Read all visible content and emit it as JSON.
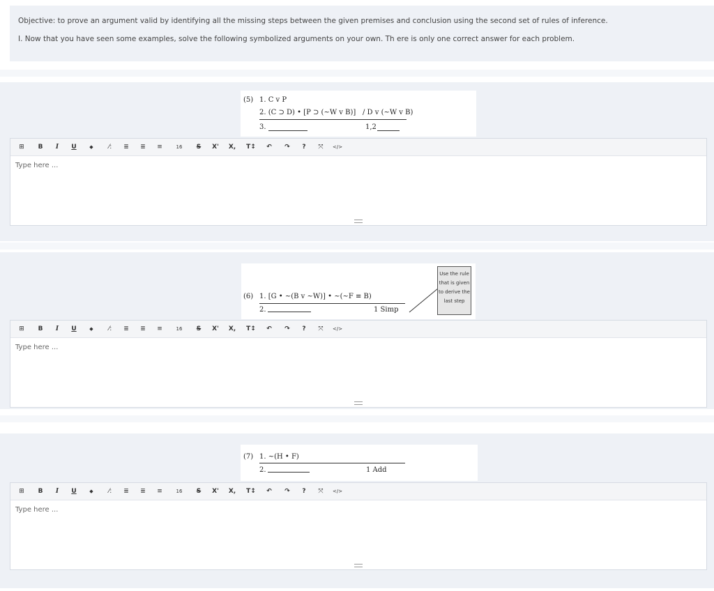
{
  "intro": {
    "objective": "Objective: to prove an argument valid by identifying all the missing steps between the given premises and conclusion using the second set of rules of inference.",
    "instruction": "I. Now that you have seen some examples, solve the following symbolized arguments on your own. Th ere is only one correct answer for each problem."
  },
  "toolbar": {
    "table": "⊞",
    "bold": "B",
    "italic": "I",
    "underline": "U",
    "marker": "◆",
    "magic": "⁄:",
    "list1": "≣",
    "list2": "≣",
    "align": "≡",
    "fontsize": "16",
    "strike": "S",
    "sup": "X'",
    "sub": "X,",
    "textstyle": "T↕",
    "undo": "↶",
    "redo": "↷",
    "help": "?",
    "fullscreen": "⤧",
    "code": "</>"
  },
  "problems": [
    {
      "number": "(5)",
      "lines": [
        "1. C v P",
        "2. (C ⊃ D) • [P ⊃ (~W v B)]",
        "3."
      ],
      "conclusion": "/ D v (~W v B)",
      "justification": "1,2",
      "placeholder": "Type here ..."
    },
    {
      "number": "(6)",
      "lines": [
        "1. [G • ~(B v ~W)] • ~(~F ≡ B)",
        "2."
      ],
      "justification": "1  Simp",
      "callout": "Use the rule that is given to derive the last step",
      "placeholder": "Type here ..."
    },
    {
      "number": "(7)",
      "lines": [
        "1. ~(H • F)",
        "2."
      ],
      "justification": "1  Add",
      "placeholder": "Type here ..."
    }
  ]
}
